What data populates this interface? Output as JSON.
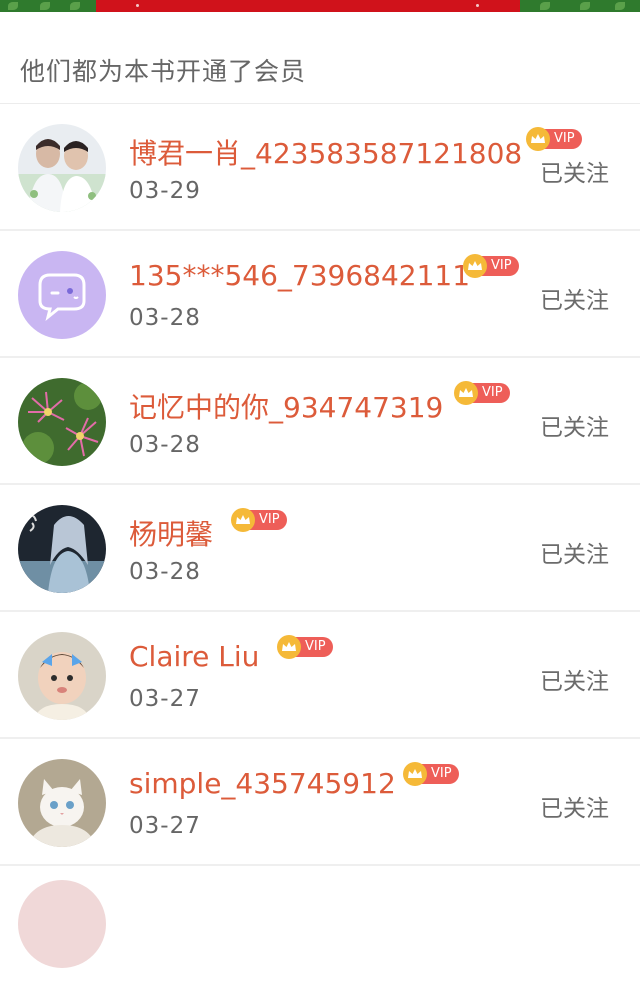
{
  "header": {
    "title": "他们都为本书开通了会员"
  },
  "vip_label": "VIP",
  "colors": {
    "name": "#dc5b3a",
    "vip_badge": "#ee5e58",
    "crown": "#f5b938",
    "banner_red": "#d0121b"
  },
  "members": [
    {
      "name": "博君一肖_423583587121808",
      "date": "03-29",
      "follow_label": "已关注",
      "avatar": "two-people-photo"
    },
    {
      "name": "135***546_7396842111",
      "date": "03-28",
      "follow_label": "已关注",
      "avatar": "default-chat-bubble-avatar"
    },
    {
      "name": "记忆中的你_934747319",
      "date": "03-28",
      "follow_label": "已关注",
      "avatar": "pink-flowers-photo"
    },
    {
      "name": "杨明馨",
      "date": "03-28",
      "follow_label": "已关注",
      "avatar": "fantasy-character-art"
    },
    {
      "name": "Claire  Liu",
      "date": "03-27",
      "follow_label": "已关注",
      "avatar": "baby-photo"
    },
    {
      "name": "simple_435745912",
      "date": "03-27",
      "follow_label": "已关注",
      "avatar": "white-kitten-photo"
    }
  ]
}
